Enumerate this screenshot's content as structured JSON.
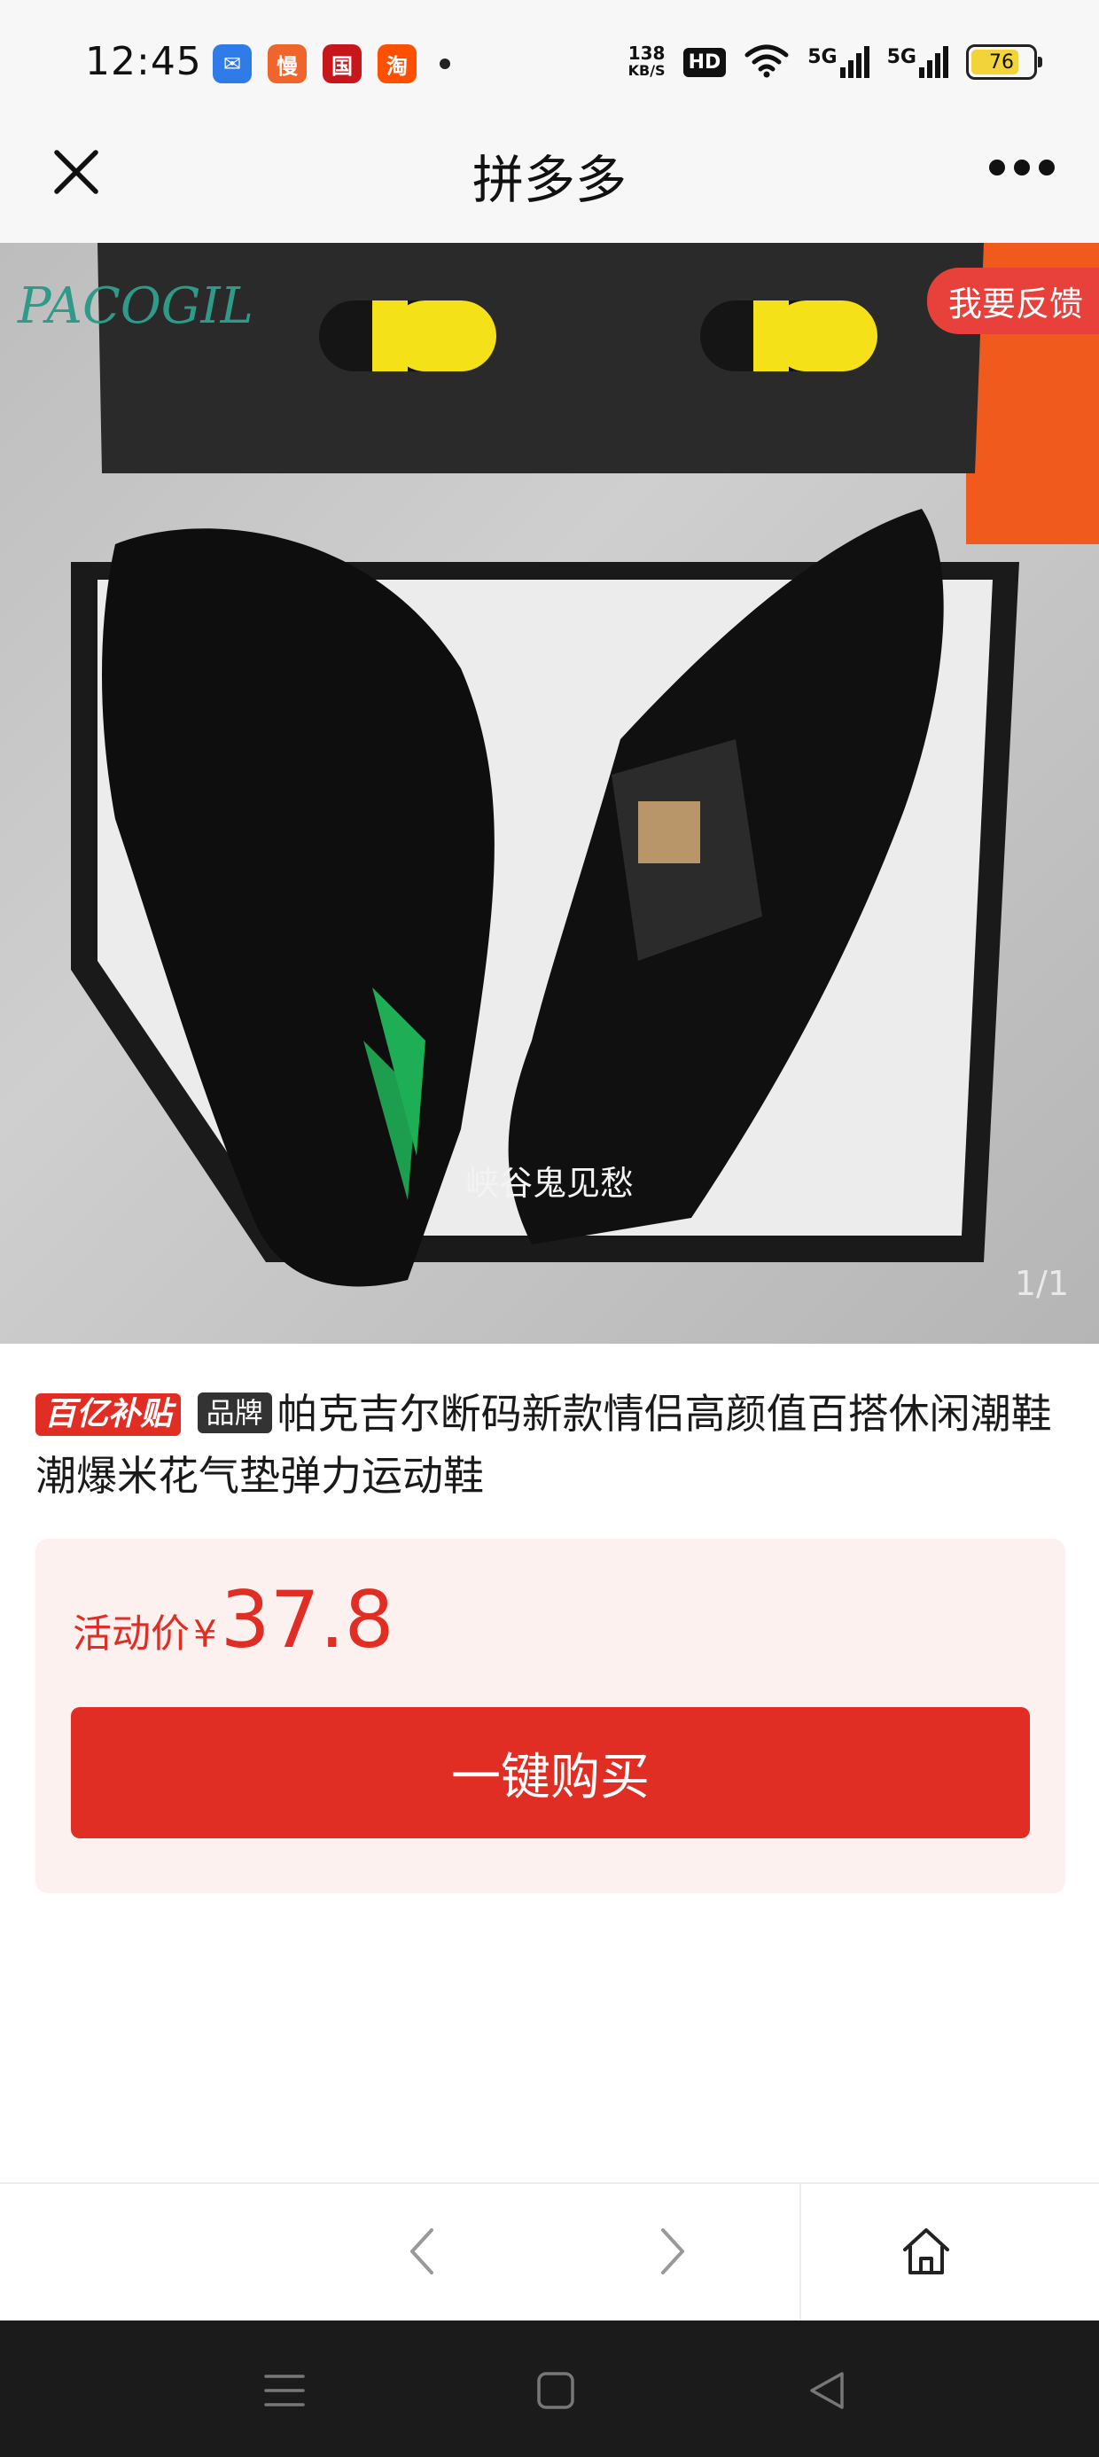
{
  "status_bar": {
    "time": "12:45",
    "app_icons": [
      {
        "name": "mail-app-icon",
        "glyph": "✉",
        "color": "#2f7ce8"
      },
      {
        "name": "slow-app-icon",
        "glyph": "慢",
        "color": "#f0652c"
      },
      {
        "name": "bank-app-icon",
        "glyph": "国",
        "color": "#c8161d"
      },
      {
        "name": "taobao-app-icon",
        "glyph": "淘",
        "color": "#ff5000"
      }
    ],
    "net_speed_value": "138",
    "net_speed_unit": "KB/S",
    "hd_label": "HD",
    "sim1_label": "5G",
    "sim2_label": "5G",
    "battery_level": "76"
  },
  "title_bar": {
    "title": "拼多多"
  },
  "product_image": {
    "feedback_label": "我要反馈",
    "pager": "1/1",
    "watermark": "峡谷鬼见愁",
    "brand_text": "PACOGIL",
    "tag_text": "PACOGIL"
  },
  "product": {
    "badge_subsidy": "百亿补贴",
    "badge_brand": "品牌",
    "title": "帕克吉尔断码新款情侣高颜值百搭休闲潮鞋潮爆米花气垫弹力运动鞋"
  },
  "price": {
    "label": "活动价",
    "currency": "¥",
    "value": "37.8",
    "buy_label": "一键购买"
  },
  "colors": {
    "accent": "#e02e24",
    "price_bg": "#fdf1ef"
  }
}
